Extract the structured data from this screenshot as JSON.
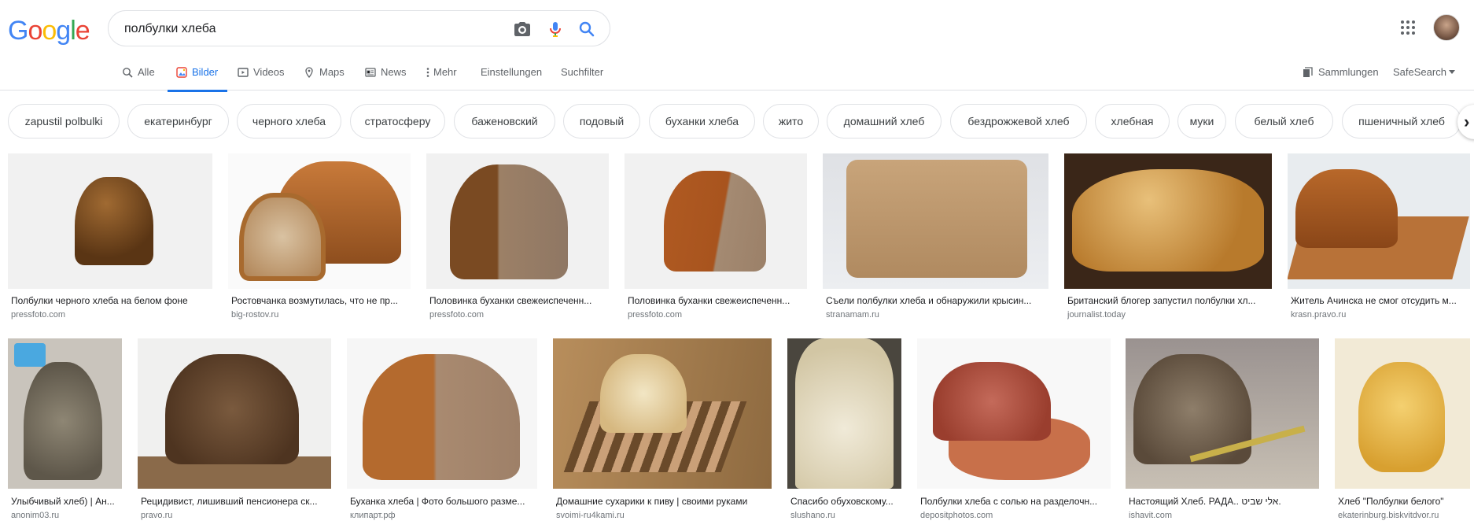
{
  "logo": [
    "G",
    "o",
    "o",
    "g",
    "l",
    "e"
  ],
  "logo_colors": [
    "#4285f4",
    "#ea4335",
    "#fbbc05",
    "#4285f4",
    "#34a853",
    "#ea4335"
  ],
  "search": {
    "query": "полбулки хлеба"
  },
  "icons": {
    "camera": "camera-icon",
    "mic": "mic-icon",
    "search": "search-icon",
    "apps": "apps-grid-icon"
  },
  "tabs": [
    {
      "label": "Alle",
      "icon": "search-icon"
    },
    {
      "label": "Bilder",
      "icon": "image-icon",
      "active": true
    },
    {
      "label": "Videos",
      "icon": "video-icon"
    },
    {
      "label": "Maps",
      "icon": "map-pin-icon"
    },
    {
      "label": "News",
      "icon": "news-icon"
    },
    {
      "label": "Mehr",
      "icon": "more-vert-icon"
    },
    {
      "label": "Einstellungen"
    },
    {
      "label": "Suchfilter"
    }
  ],
  "right_tools": {
    "collections": "Sammlungen",
    "safesearch": "SafeSearch"
  },
  "chips": [
    "zapustil polbulki",
    "екатеринбург",
    "черного хлеба",
    "стратосферу",
    "баженовский",
    "подовый",
    "буханки хлеба",
    "жито",
    "домашний хлеб",
    "бездрожжевой хлеб",
    "хлебная",
    "муки",
    "белый хлеб",
    "пшеничный хлеб"
  ],
  "accent": "#1a73e8",
  "results_row1": [
    {
      "title": "Полбулки черного хлеба на белом фоне",
      "source": "pressfoto.com"
    },
    {
      "title": "Ростовчанка возмутилась, что не пр...",
      "source": "big-rostov.ru"
    },
    {
      "title": "Половинка буханки свежеиспеченн...",
      "source": "pressfoto.com"
    },
    {
      "title": "Половинка буханки свежеиспеченн...",
      "source": "pressfoto.com"
    },
    {
      "title": "Съели полбулки хлеба и обнаружили крысин...",
      "source": "stranamam.ru"
    },
    {
      "title": "Британский блогер запустил полбулки хл...",
      "source": "journalist.today"
    },
    {
      "title": "Житель Ачинска не смог отсудить м...",
      "source": "krasn.pravo.ru"
    }
  ],
  "results_row2": [
    {
      "title": "Улыбчивый хлеб) | Ан...",
      "source": "anonim03.ru"
    },
    {
      "title": "Рецидивист, лишивший пенсионера ск...",
      "source": "pravo.ru"
    },
    {
      "title": "Буханка хлеба | Фото большого разме...",
      "source": "клипарт.рф"
    },
    {
      "title": "Домашние сухарики к пиву | своими руками",
      "source": "svoimi-ru4kami.ru"
    },
    {
      "title": "Спасибо обуховскому...",
      "source": "slushano.ru"
    },
    {
      "title": "Полбулки хлеба с солью на разделочн...",
      "source": "depositphotos.com"
    },
    {
      "title": "Настоящий Хлеб. РАДА.. אלי שביט.",
      "source": "ishavit.com"
    },
    {
      "title": "Хлеб \"Полбулки белого\"",
      "source": "ekaterinburg.biskvitdvor.ru"
    }
  ]
}
